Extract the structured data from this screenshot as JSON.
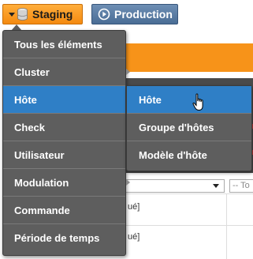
{
  "header": {
    "env_staging_label": "Staging",
    "env_production_label": "Production",
    "colors": {
      "staging": "#f48a10",
      "production": "#4a6d95"
    }
  },
  "main_menu": {
    "items": [
      {
        "label": "Tous les éléments",
        "submenu": false,
        "active": false
      },
      {
        "label": "Cluster",
        "submenu": true,
        "active": false
      },
      {
        "label": "Hôte",
        "submenu": true,
        "active": true
      },
      {
        "label": "Check",
        "submenu": true,
        "active": false
      },
      {
        "label": "Utilisateur",
        "submenu": true,
        "active": false
      },
      {
        "label": "Modulation",
        "submenu": true,
        "active": false
      },
      {
        "label": "Commande",
        "submenu": false,
        "active": false
      },
      {
        "label": "Période de temps",
        "submenu": false,
        "active": false
      }
    ]
  },
  "sub_menu": {
    "items": [
      {
        "label": "Hôte",
        "active": true
      },
      {
        "label": "Groupe d'hôtes",
        "active": false
      },
      {
        "label": "Modèle d'hôte",
        "active": false
      }
    ]
  },
  "background": {
    "filter_placeholder": "-- To",
    "row1_fragment": "ué]",
    "row2_fragment": "ué]"
  },
  "accent_color": "#2f7fc6",
  "icons": [
    "database-icon",
    "play-circle-icon",
    "caret-down-icon",
    "pointer-hand-cursor-icon"
  ]
}
